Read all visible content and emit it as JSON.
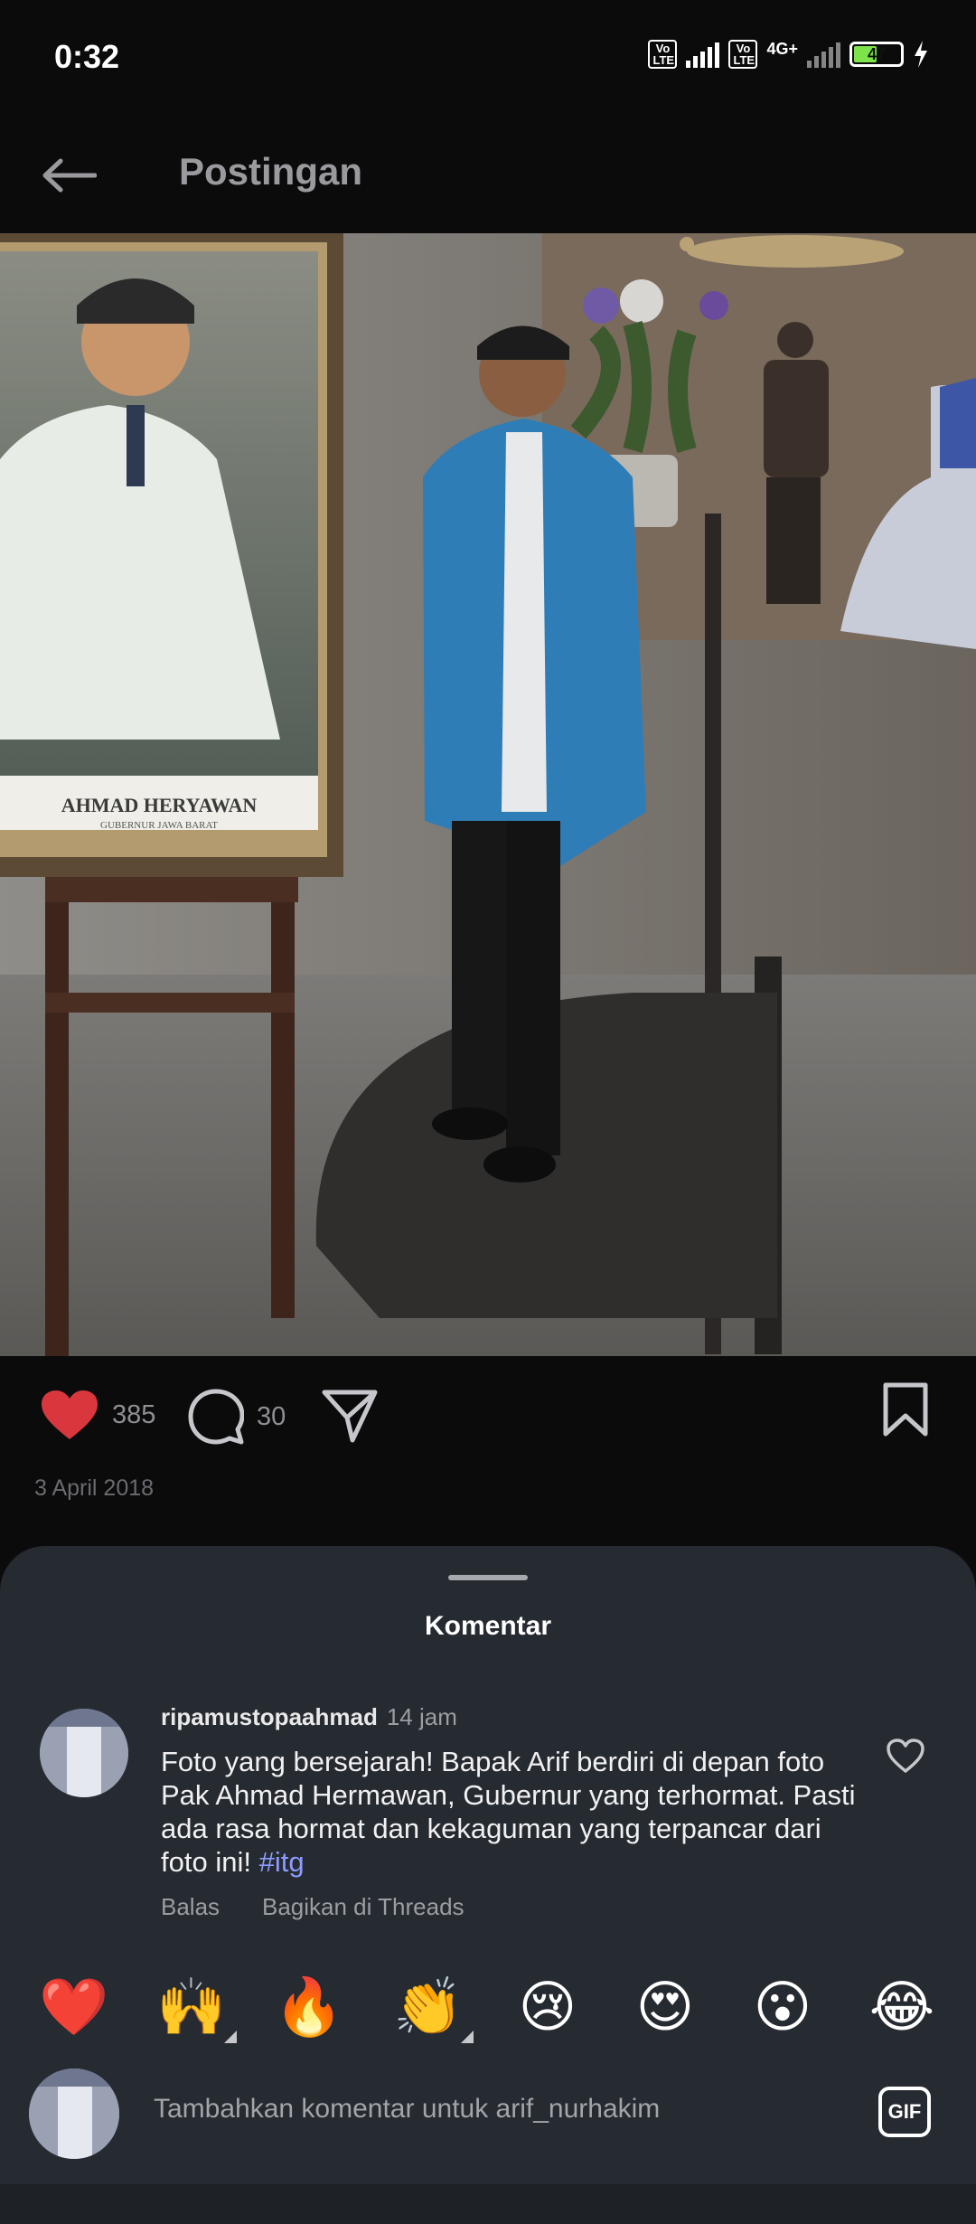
{
  "status_bar": {
    "time": "0:32",
    "volte1": "Vo LTE",
    "volte2": "Vo LTE",
    "network": "4G+",
    "battery": "47"
  },
  "header": {
    "title": "Postingan"
  },
  "post": {
    "portrait_caption_name": "AHMAD HERYAWAN",
    "portrait_caption_title": "GUBERNUR JAWA BARAT",
    "likes": "385",
    "comments": "30",
    "date": "3 April 2018"
  },
  "comments_sheet": {
    "title": "Komentar",
    "comment": {
      "username": "ripamustopaahmad",
      "time": "14 jam",
      "text": "Foto yang bersejarah! Bapak Arif berdiri di depan foto Pak Ahmad Hermawan, Gubernur yang terhormat. Pasti ada rasa hormat dan kekaguman yang terpancar dari foto ini!",
      "hashtag": "#itg",
      "reply_label": "Balas",
      "share_label": "Bagikan di Threads"
    },
    "reactions": [
      "❤️",
      "🙌",
      "🔥",
      "👏",
      "😢",
      "😍",
      "😮",
      "😂"
    ],
    "composer": {
      "placeholder": "Tambahkan komentar untuk arif_nurhakim",
      "gif_label": "GIF"
    }
  },
  "colors": {
    "background": "#0b0b0c",
    "sheet": "#262a31",
    "like_red": "#d9363e",
    "hashtag": "#8c9bff"
  }
}
